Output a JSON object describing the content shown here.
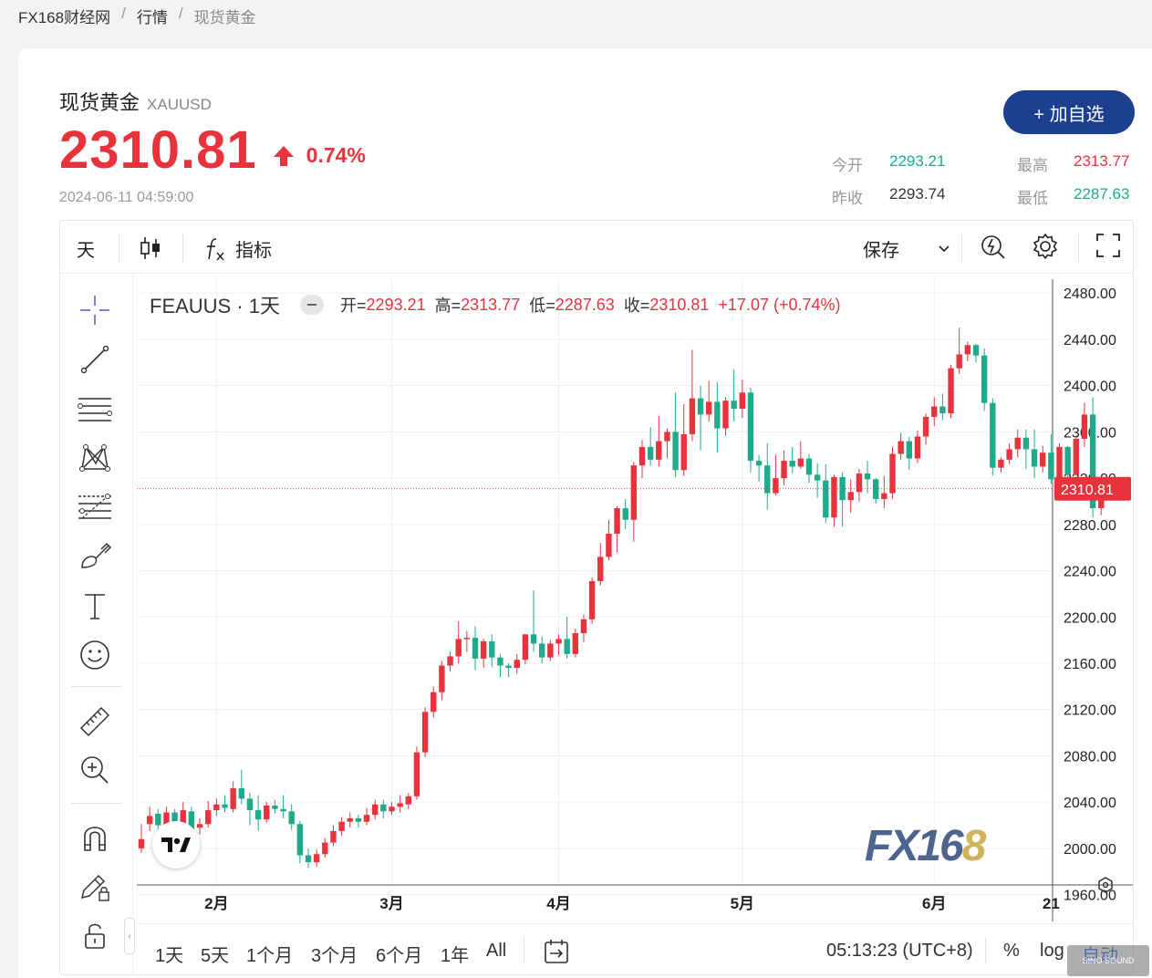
{
  "breadcrumb": [
    "FX168财经网",
    "行情",
    "现货黄金"
  ],
  "instrument": {
    "name": "现货黄金",
    "code": "XAUUSD",
    "price": "2310.81",
    "change_pct": "0.74%",
    "timestamp": "2024-06-11 04:59:00"
  },
  "add_button": "+ 加自选",
  "stats": {
    "open_label": "今开",
    "open_value": "2293.21",
    "high_label": "最高",
    "high_value": "2313.77",
    "prev_close_label": "昨收",
    "prev_close_value": "2293.74",
    "low_label": "最低",
    "low_value": "2287.63"
  },
  "toolbar": {
    "interval": "天",
    "indicators": "指标",
    "save": "保存"
  },
  "legend": {
    "symbol": "FEAUUS · 1天",
    "open_key": "开=",
    "open": "2293.21",
    "high_key": "高=",
    "high": "2313.77",
    "low_key": "低=",
    "low": "2287.63",
    "close_key": "收=",
    "close": "2310.81",
    "change": "+17.07 (+0.74%)"
  },
  "watermark": {
    "prefix": "FX16",
    "suffix": "8"
  },
  "bottom_bar": {
    "ranges": [
      "1天",
      "5天",
      "1个月",
      "3个月",
      "6个月",
      "1年",
      "All"
    ],
    "clock": "05:13:23 (UTC+8)",
    "pct": "%",
    "log": "log",
    "auto": "自动"
  },
  "corner_logo": "SINO SOUND",
  "colors": {
    "up": "#e8333d",
    "down": "#1faa8c",
    "accent": "#1d3f8f"
  },
  "chart_data": {
    "type": "candlestick",
    "y_ticks": [
      1960,
      2000,
      2040,
      2080,
      2120,
      2160,
      2200,
      2240,
      2280,
      2320,
      2360,
      2400,
      2440,
      2480
    ],
    "ylim": [
      1940,
      2492
    ],
    "x_labels": [
      {
        "label": "2月",
        "index": 9
      },
      {
        "label": "3月",
        "index": 30
      },
      {
        "label": "4月",
        "index": 50
      },
      {
        "label": "5月",
        "index": 72
      },
      {
        "label": "6月",
        "index": 95
      },
      {
        "label": "21",
        "index": 109
      }
    ],
    "last_price": 2310.81,
    "last_price_label": "2310.81",
    "candles": [
      [
        2000,
        2008,
        1996,
        2021
      ],
      [
        2021,
        2028,
        2015,
        2036
      ],
      [
        2030,
        2020,
        2014,
        2034
      ],
      [
        2020,
        2031,
        2016,
        2036
      ],
      [
        2031,
        2019,
        2012,
        2034
      ],
      [
        2019,
        2033,
        2016,
        2040
      ],
      [
        2032,
        2017,
        2011,
        2036
      ],
      [
        2018,
        2021,
        2012,
        2026
      ],
      [
        2021,
        2033,
        2018,
        2041
      ],
      [
        2033,
        2038,
        2028,
        2043
      ],
      [
        2038,
        2035,
        2031,
        2046
      ],
      [
        2034,
        2052,
        2031,
        2058
      ],
      [
        2052,
        2043,
        2038,
        2068
      ],
      [
        2043,
        2033,
        2020,
        2048
      ],
      [
        2033,
        2025,
        2015,
        2046
      ],
      [
        2025,
        2037,
        2022,
        2040
      ],
      [
        2037,
        2034,
        2030,
        2042
      ],
      [
        2034,
        2032,
        2026,
        2046
      ],
      [
        2032,
        2021,
        2016,
        2038
      ],
      [
        2021,
        1994,
        1987,
        2024
      ],
      [
        1994,
        1988,
        1983,
        2000
      ],
      [
        1988,
        1995,
        1984,
        1999
      ],
      [
        1995,
        2005,
        1992,
        2009
      ],
      [
        2005,
        2015,
        2002,
        2020
      ],
      [
        2015,
        2023,
        2011,
        2027
      ],
      [
        2023,
        2026,
        2018,
        2031
      ],
      [
        2026,
        2023,
        2018,
        2029
      ],
      [
        2023,
        2029,
        2020,
        2035
      ],
      [
        2029,
        2038,
        2025,
        2042
      ],
      [
        2038,
        2032,
        2026,
        2042
      ],
      [
        2032,
        2036,
        2029,
        2040
      ],
      [
        2036,
        2039,
        2031,
        2046
      ],
      [
        2038,
        2045,
        2034,
        2048
      ],
      [
        2045,
        2083,
        2042,
        2088
      ],
      [
        2083,
        2118,
        2079,
        2122
      ],
      [
        2118,
        2135,
        2113,
        2140
      ],
      [
        2135,
        2158,
        2128,
        2162
      ],
      [
        2158,
        2166,
        2153,
        2170
      ],
      [
        2166,
        2181,
        2160,
        2196
      ],
      [
        2181,
        2182,
        2170,
        2188
      ],
      [
        2182,
        2164,
        2154,
        2192
      ],
      [
        2164,
        2179,
        2156,
        2181
      ],
      [
        2179,
        2165,
        2157,
        2185
      ],
      [
        2165,
        2158,
        2148,
        2168
      ],
      [
        2158,
        2156,
        2148,
        2160
      ],
      [
        2156,
        2163,
        2151,
        2168
      ],
      [
        2163,
        2185,
        2159,
        2185
      ],
      [
        2185,
        2177,
        2170,
        2223
      ],
      [
        2177,
        2165,
        2160,
        2183
      ],
      [
        2165,
        2177,
        2162,
        2180
      ],
      [
        2177,
        2181,
        2167,
        2185
      ],
      [
        2181,
        2168,
        2164,
        2200
      ],
      [
        2168,
        2186,
        2165,
        2190
      ],
      [
        2186,
        2198,
        2178,
        2202
      ],
      [
        2198,
        2231,
        2194,
        2234
      ],
      [
        2231,
        2252,
        2227,
        2264
      ],
      [
        2252,
        2272,
        2249,
        2284
      ],
      [
        2272,
        2294,
        2256,
        2296
      ],
      [
        2294,
        2284,
        2276,
        2302
      ],
      [
        2284,
        2331,
        2265,
        2334
      ],
      [
        2331,
        2347,
        2320,
        2353
      ],
      [
        2347,
        2336,
        2331,
        2364
      ],
      [
        2336,
        2352,
        2330,
        2374
      ],
      [
        2352,
        2360,
        2337,
        2363
      ],
      [
        2360,
        2327,
        2321,
        2394
      ],
      [
        2327,
        2358,
        2322,
        2384
      ],
      [
        2358,
        2389,
        2352,
        2431
      ],
      [
        2389,
        2375,
        2344,
        2400
      ],
      [
        2375,
        2386,
        2369,
        2404
      ],
      [
        2386,
        2363,
        2342,
        2403
      ],
      [
        2363,
        2387,
        2357,
        2390
      ],
      [
        2387,
        2380,
        2369,
        2414
      ],
      [
        2380,
        2394,
        2372,
        2405
      ],
      [
        2394,
        2335,
        2325,
        2398
      ],
      [
        2335,
        2331,
        2317,
        2340
      ],
      [
        2331,
        2307,
        2293,
        2350
      ],
      [
        2307,
        2320,
        2305,
        2340
      ],
      [
        2320,
        2335,
        2314,
        2344
      ],
      [
        2335,
        2330,
        2324,
        2347
      ],
      [
        2330,
        2337,
        2328,
        2352
      ],
      [
        2337,
        2323,
        2316,
        2341
      ],
      [
        2323,
        2318,
        2303,
        2333
      ],
      [
        2318,
        2286,
        2281,
        2332
      ],
      [
        2286,
        2321,
        2278,
        2323
      ],
      [
        2321,
        2301,
        2278,
        2325
      ],
      [
        2301,
        2308,
        2290,
        2319
      ],
      [
        2308,
        2324,
        2300,
        2328
      ],
      [
        2324,
        2319,
        2307,
        2335
      ],
      [
        2319,
        2302,
        2298,
        2320
      ],
      [
        2302,
        2307,
        2294,
        2322
      ],
      [
        2307,
        2341,
        2302,
        2347
      ],
      [
        2341,
        2352,
        2336,
        2359
      ],
      [
        2352,
        2337,
        2327,
        2356
      ],
      [
        2337,
        2356,
        2333,
        2361
      ],
      [
        2356,
        2373,
        2349,
        2376
      ],
      [
        2373,
        2382,
        2365,
        2390
      ],
      [
        2382,
        2376,
        2370,
        2393
      ],
      [
        2376,
        2415,
        2372,
        2418
      ],
      [
        2415,
        2427,
        2410,
        2450
      ],
      [
        2427,
        2435,
        2421,
        2438
      ],
      [
        2435,
        2426,
        2420,
        2436
      ],
      [
        2426,
        2385,
        2378,
        2432
      ],
      [
        2385,
        2329,
        2322,
        2389
      ],
      [
        2329,
        2336,
        2325,
        2338
      ],
      [
        2336,
        2345,
        2332,
        2350
      ],
      [
        2345,
        2355,
        2338,
        2362
      ],
      [
        2355,
        2345,
        2328,
        2362
      ],
      [
        2345,
        2330,
        2320,
        2362
      ],
      [
        2330,
        2342,
        2325,
        2348
      ],
      [
        2342,
        2319,
        2315,
        2358
      ],
      [
        2319,
        2347,
        2314,
        2350
      ],
      [
        2347,
        2323,
        2315,
        2348
      ],
      [
        2323,
        2354,
        2322,
        2357
      ],
      [
        2354,
        2375,
        2347,
        2385
      ],
      [
        2375,
        2294,
        2286,
        2390
      ],
      [
        2294,
        2311,
        2288,
        2314
      ]
    ]
  }
}
